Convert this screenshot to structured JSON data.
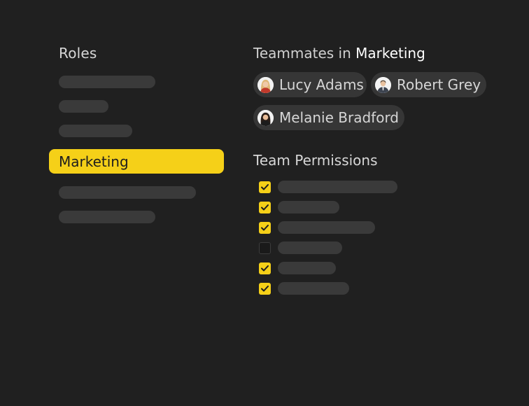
{
  "colors": {
    "background": "#202020",
    "accent": "#f5d018",
    "placeholder": "#3a3a3a",
    "chip": "#363636"
  },
  "roles": {
    "title": "Roles",
    "selected_label": "Marketing"
  },
  "teammates": {
    "title_prefix": "Teammates in",
    "team_name": "Marketing",
    "members": [
      {
        "name": "Lucy Adams",
        "avatar": "woman-blonde-avatar"
      },
      {
        "name": "Robert Grey",
        "avatar": "man-suit-avatar"
      },
      {
        "name": "Melanie Bradford",
        "avatar": "woman-dark-hair-avatar"
      }
    ]
  },
  "permissions": {
    "title": "Team Permissions",
    "items": [
      {
        "checked": true
      },
      {
        "checked": true
      },
      {
        "checked": true
      },
      {
        "checked": false
      },
      {
        "checked": true
      },
      {
        "checked": true
      }
    ]
  }
}
